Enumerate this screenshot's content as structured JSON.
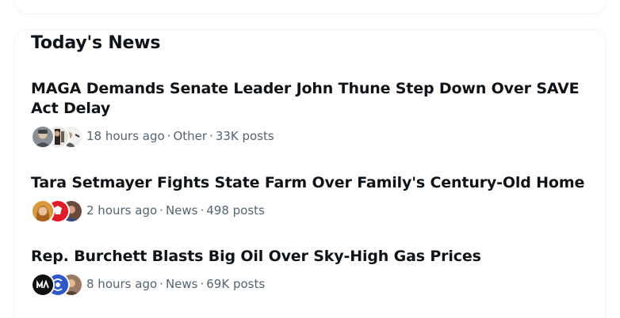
{
  "section": {
    "title": "Today's News"
  },
  "items": [
    {
      "headline": "MAGA Demands Senate Leader John Thune Step Down Over SAVE Act Delay",
      "time": "18 hours ago",
      "category": "Other",
      "posts": "33K posts",
      "avatars": [
        "person-avatar",
        "person-avatar",
        "person-avatar"
      ]
    },
    {
      "headline": "Tara Setmayer Fights State Farm Over Family's Century-Old Home",
      "time": "2 hours ago",
      "category": "News",
      "posts": "498 posts",
      "avatars": [
        "person-avatar",
        "news-logo-avatar",
        "person-avatar"
      ]
    },
    {
      "headline": "Rep. Burchett Blasts Big Oil Over Sky-High Gas Prices",
      "time": "8 hours ago",
      "category": "News",
      "posts": "69K posts",
      "avatars": [
        "logo-avatar",
        "podcast-logo-avatar",
        "person-avatar"
      ]
    }
  ],
  "separator": "·",
  "colors": {
    "text_primary": "#0f1419",
    "text_secondary": "#536471",
    "border": "#eff3f4"
  }
}
